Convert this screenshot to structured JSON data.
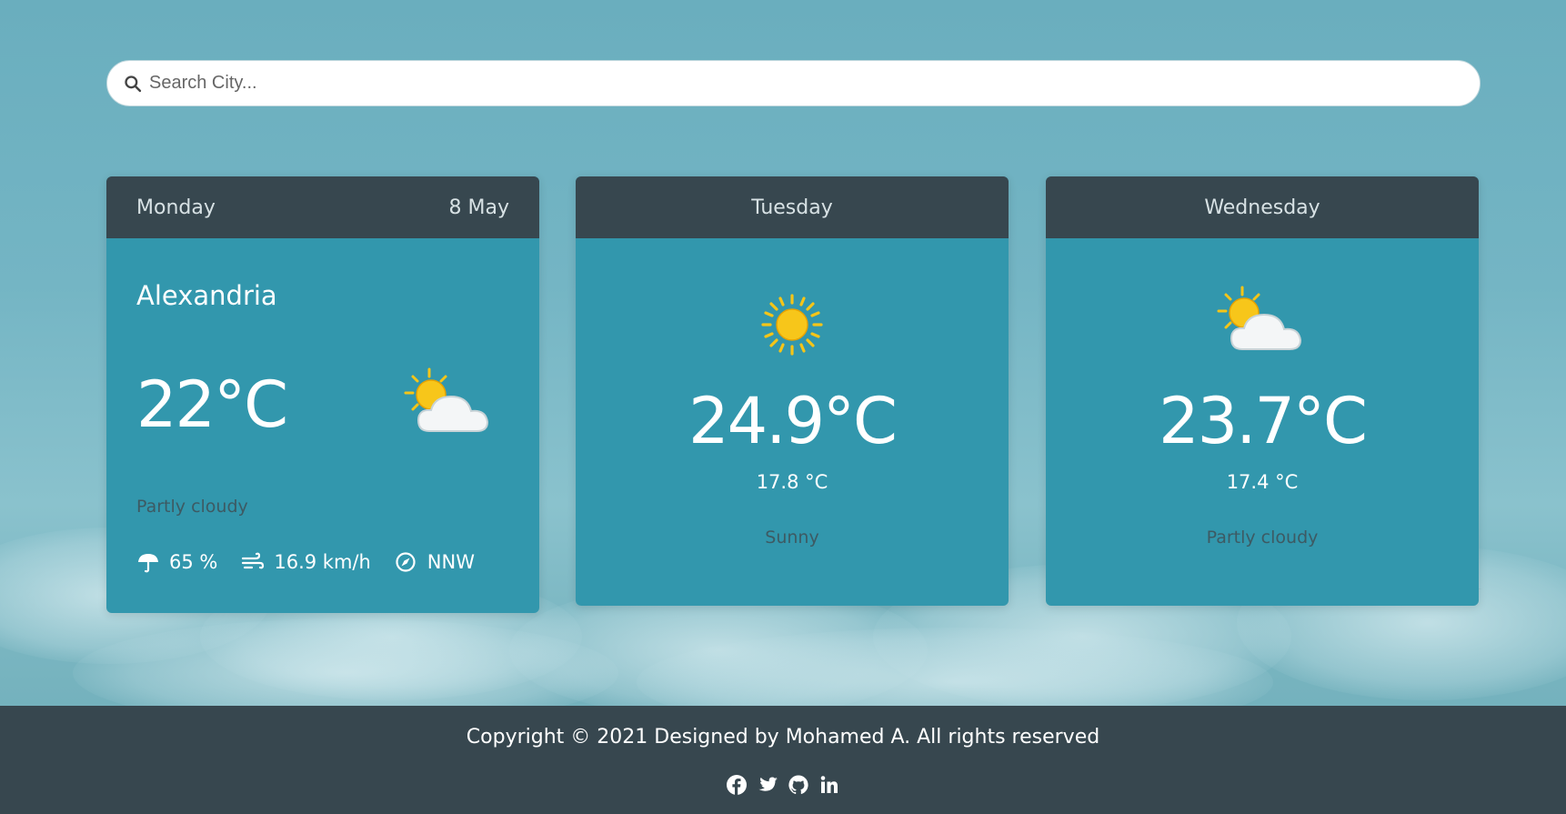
{
  "search": {
    "placeholder": "Search City..."
  },
  "today": {
    "day": "Monday",
    "date": "8 May",
    "city": "Alexandria",
    "temp": "22°C",
    "condition": "Partly cloudy",
    "icon": "partly-cloudy-icon",
    "humidity": "65 %",
    "wind_speed": "16.9 km/h",
    "wind_direction": "NNW"
  },
  "forecast": [
    {
      "day": "Tuesday",
      "temp": "24.9°C",
      "min_temp": "17.8 °C",
      "condition": "Sunny",
      "icon": "sunny-icon"
    },
    {
      "day": "Wednesday",
      "temp": "23.7°C",
      "min_temp": "17.4 °C",
      "condition": "Partly cloudy",
      "icon": "partly-cloudy-icon"
    }
  ],
  "footer": {
    "copyright": "Copyright © 2021 Designed by Mohamed A. All rights reserved",
    "socials": [
      "facebook-icon",
      "twitter-icon",
      "github-icon",
      "linkedin-icon"
    ]
  },
  "colors": {
    "card_body": "#3297ad",
    "card_header": "#37474f",
    "footer": "#37474f",
    "condition_text": "#3d5a63"
  }
}
